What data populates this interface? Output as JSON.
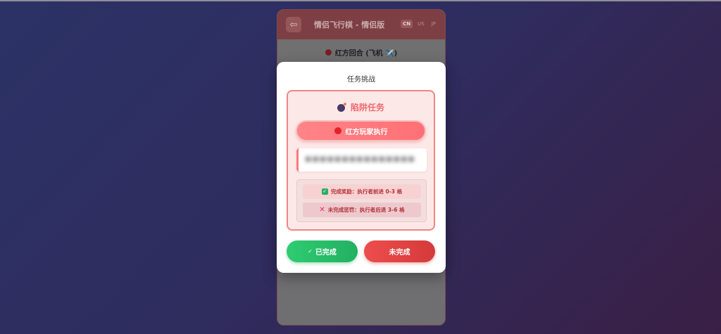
{
  "app": {
    "back_icon": "arrow-left-icon",
    "title": "情侣飞行棋 - 情侣版",
    "languages": [
      "CN",
      "US",
      "JP"
    ],
    "active_language": "CN",
    "turn_indicator": "红方回合 (飞机 ✈️)",
    "turn_color": "#d0202a"
  },
  "modal": {
    "title": "任务挑战",
    "task": {
      "icon": "bomb-icon",
      "name": "陷阱任务",
      "player_label": "红方玩家执行",
      "player_color": "#e3202a",
      "description": "■■■■■■■■■■■■■■■",
      "reward": "完成奖励：执行者前进 0-3 格",
      "penalty": "未完成惩罚：执行者后退 3-6 格"
    },
    "buttons": {
      "done": "已完成",
      "fail": "未完成"
    }
  },
  "colors": {
    "accent_red": "#f16a70",
    "success_green": "#2ecc71",
    "danger_red": "#d43a3a"
  }
}
